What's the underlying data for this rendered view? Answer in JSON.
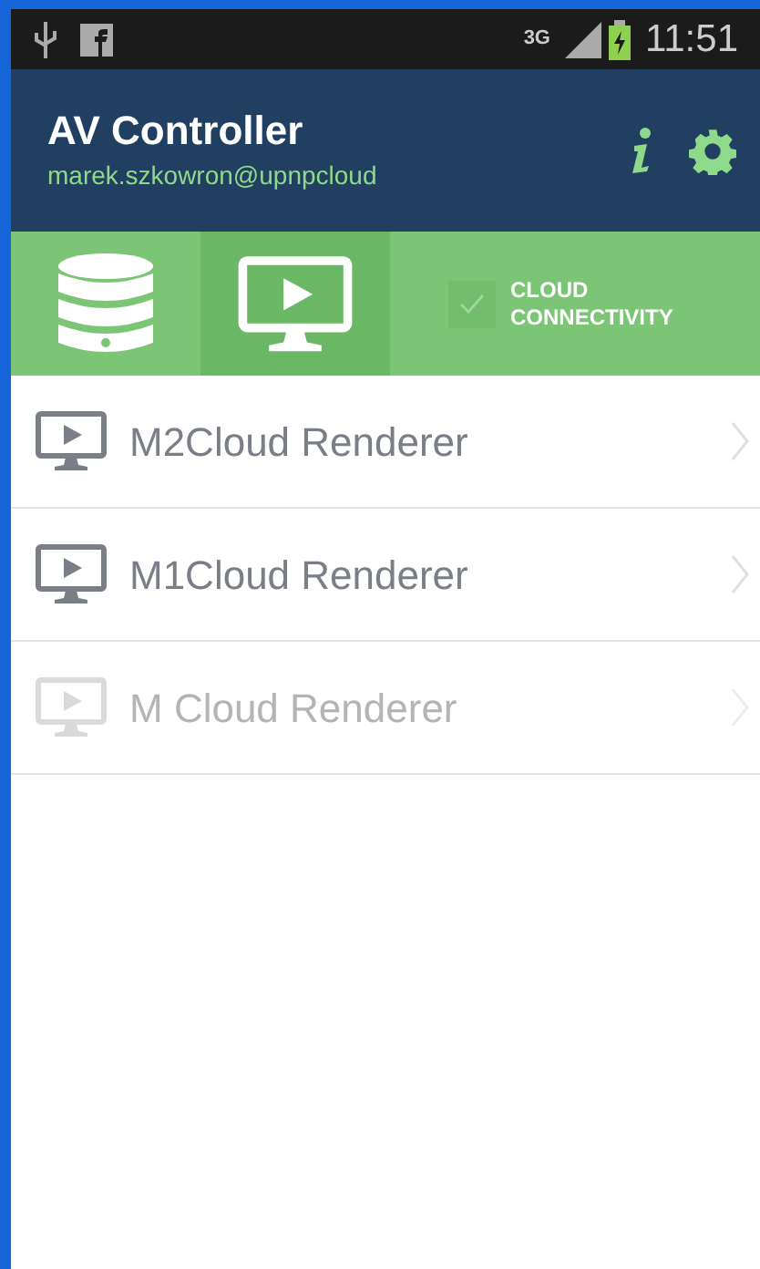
{
  "status_bar": {
    "network": "3G",
    "time": "11:51"
  },
  "header": {
    "title": "AV Controller",
    "subtitle": "marek.szkowron@upnpcloud"
  },
  "tabs": [
    {
      "kind": "database",
      "selected": false
    },
    {
      "kind": "player",
      "selected": true
    }
  ],
  "cloud_toggle": {
    "label": "CLOUD CONNECTIVITY",
    "checked": false
  },
  "renderers": [
    {
      "name": "M2Cloud Renderer",
      "disabled": false
    },
    {
      "name": "M1Cloud Renderer",
      "disabled": false
    },
    {
      "name": "M Cloud Renderer",
      "disabled": true
    }
  ]
}
